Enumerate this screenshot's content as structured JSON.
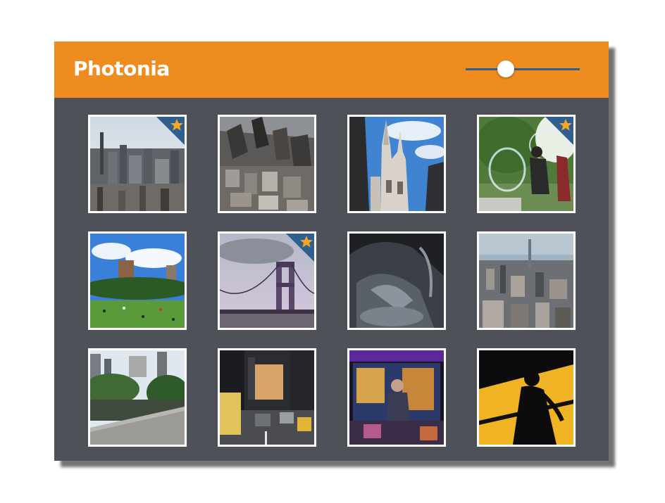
{
  "app": {
    "title": "Photonia"
  },
  "zoom_slider": {
    "value": 0.35
  },
  "colors": {
    "header": "#ef8c20",
    "panel": "#4e5157",
    "accent": "#2f5f8e",
    "star": "#f5a623"
  },
  "photos": [
    {
      "subject": "city-skyline",
      "favorite": true
    },
    {
      "subject": "aerial-city",
      "favorite": false
    },
    {
      "subject": "cathedral-spires",
      "favorite": false
    },
    {
      "subject": "bubble-performer",
      "favorite": true
    },
    {
      "subject": "park-lawn",
      "favorite": false
    },
    {
      "subject": "bridge-tower",
      "favorite": true
    },
    {
      "subject": "statue-closeup",
      "favorite": false
    },
    {
      "subject": "city-panorama",
      "favorite": false
    },
    {
      "subject": "park-pond",
      "favorite": false
    },
    {
      "subject": "street-traffic",
      "favorite": false
    },
    {
      "subject": "food-cart-night",
      "favorite": false
    },
    {
      "subject": "silhouette-window",
      "favorite": false
    }
  ]
}
